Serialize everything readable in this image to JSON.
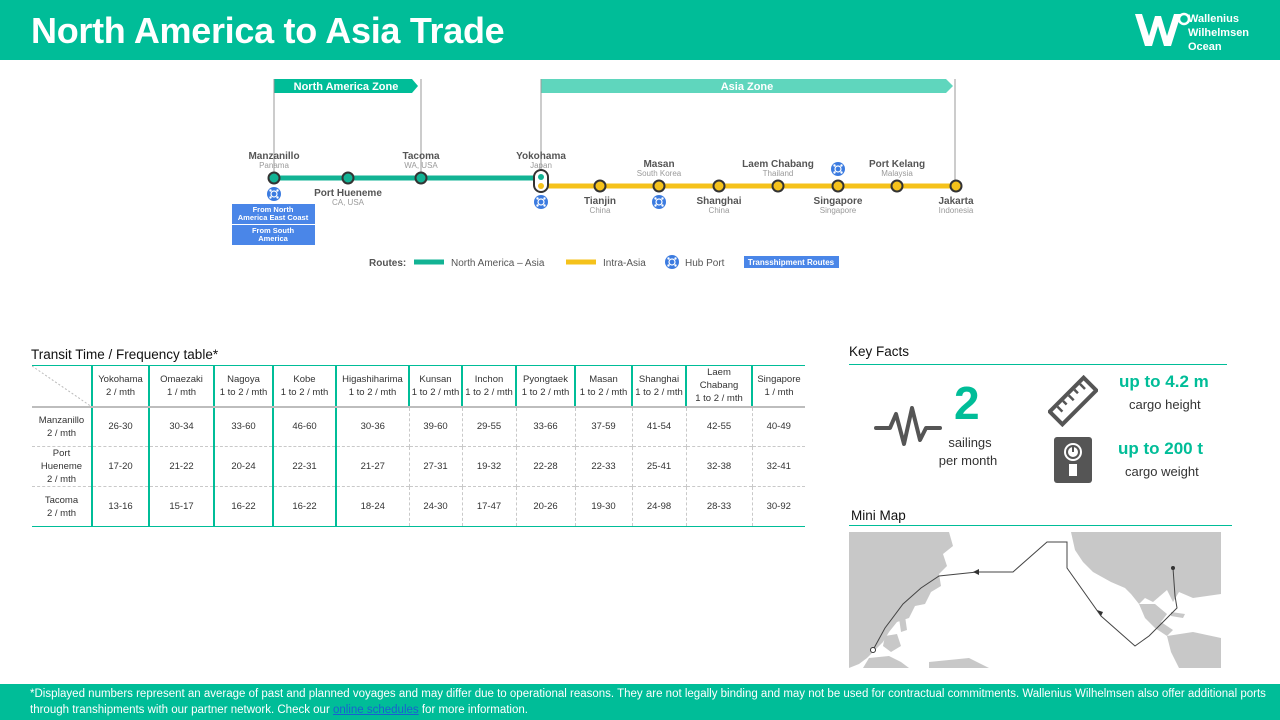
{
  "header": {
    "title": "North America to Asia Trade",
    "logo_lines": [
      "Wallenius",
      "Wilhelmsen",
      "Ocean"
    ]
  },
  "colors": {
    "brand": "#00bd98",
    "route_na_asia": "#12b394",
    "route_intra_asia": "#f5c21b",
    "hub_port": "#3b7be0",
    "transshipment": "#4a86e8"
  },
  "route_map": {
    "zones": {
      "north_america": "North America Zone",
      "asia": "Asia Zone"
    },
    "ports": {
      "manzanillo": {
        "name": "Manzanillo",
        "country": "Panama"
      },
      "port_hueneme": {
        "name": "Port Hueneme",
        "country": "CA, USA"
      },
      "tacoma": {
        "name": "Tacoma",
        "country": "WA, USA"
      },
      "yokohama": {
        "name": "Yokohama",
        "country": "Japan"
      },
      "tianjin": {
        "name": "Tianjin",
        "country": "China"
      },
      "masan": {
        "name": "Masan",
        "country": "South Korea"
      },
      "shanghai": {
        "name": "Shanghai",
        "country": "China"
      },
      "laem_chabang": {
        "name": "Laem Chabang",
        "country": "Thailand"
      },
      "singapore": {
        "name": "Singapore",
        "country": "Singapore"
      },
      "port_kelang": {
        "name": "Port Kelang",
        "country": "Malaysia"
      },
      "jakarta": {
        "name": "Jakarta",
        "country": "Indonesia"
      }
    },
    "transshipment_boxes": {
      "east_coast": [
        "From North",
        "America East Coast"
      ],
      "south_america": [
        "From South",
        "America"
      ]
    },
    "legend": {
      "routes_label": "Routes:",
      "na_asia": "North America – Asia",
      "intra_asia": "Intra-Asia",
      "hub_port": "Hub Port",
      "transshipment": "Transshipment Routes"
    }
  },
  "transit_table": {
    "title": "Transit Time / Frequency table*",
    "columns": [
      {
        "port": "Yokohama",
        "freq": "2 / mth"
      },
      {
        "port": "Omaezaki",
        "freq": "1 / mth"
      },
      {
        "port": "Nagoya",
        "freq": "1 to 2 / mth"
      },
      {
        "port": "Kobe",
        "freq": "1 to 2 / mth"
      },
      {
        "port": "Higashiharima",
        "freq": "1 to 2 / mth"
      },
      {
        "port": "Kunsan",
        "freq": "1 to 2 / mth"
      },
      {
        "port": "Inchon",
        "freq": "1 to 2 / mth"
      },
      {
        "port": "Pyongtaek",
        "freq": "1 to 2 / mth"
      },
      {
        "port": "Masan",
        "freq": "1 to 2 / mth"
      },
      {
        "port": "Shanghai",
        "freq": "1 to 2 / mth"
      },
      {
        "port": "Laem Chabang",
        "freq": "1 to 2 / mth"
      },
      {
        "port": "Singapore",
        "freq": "1 / mth"
      }
    ],
    "rows": [
      {
        "origin": "Manzanillo",
        "origin2": "",
        "freq": "2 / mth",
        "values": [
          "26-30",
          "30-34",
          "33-60",
          "46-60",
          "30-36",
          "39-60",
          "29-55",
          "33-66",
          "37-59",
          "41-54",
          "42-55",
          "40-49"
        ]
      },
      {
        "origin": "Port",
        "origin2": "Hueneme",
        "freq": "2 / mth",
        "values": [
          "17-20",
          "21-22",
          "20-24",
          "22-31",
          "21-27",
          "27-31",
          "19-32",
          "22-28",
          "22-33",
          "25-41",
          "32-38",
          "32-41"
        ]
      },
      {
        "origin": "Tacoma",
        "origin2": "",
        "freq": "2 / mth",
        "values": [
          "13-16",
          "15-17",
          "16-22",
          "16-22",
          "18-24",
          "24-30",
          "17-47",
          "20-26",
          "19-30",
          "24-98",
          "28-33",
          "30-92"
        ]
      }
    ]
  },
  "key_facts": {
    "title": "Key Facts",
    "sailings_value": "2",
    "sailings_label_1": "sailings",
    "sailings_label_2": "per month",
    "height_value": "up to 4.2 m",
    "height_label": "cargo height",
    "weight_value": "up to 200 t",
    "weight_label": "cargo weight"
  },
  "mini_map": {
    "title": "Mini Map"
  },
  "footer": {
    "text_before": "*Displayed numbers represent  an average of past and planned voyages and may differ due to operational reasons. They are not legally binding and may not be used for contractual commitments. Wallenius Wilhelmsen also offer additional ports through transhipments with our partner network.  Check our ",
    "link": "online schedules",
    "text_after": " for more information."
  }
}
